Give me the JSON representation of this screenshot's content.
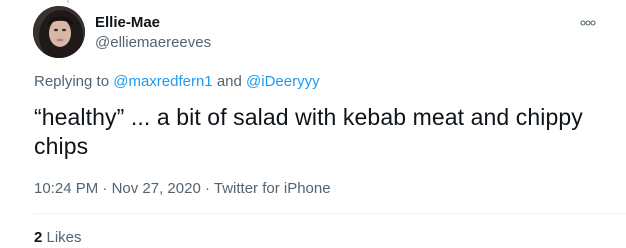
{
  "tweet": {
    "author_name": "Ellie-Mae",
    "author_handle": "@elliemaereeves",
    "replying_prefix": "Replying to ",
    "reply_to_1": "@maxredfern1",
    "reply_and": " and ",
    "reply_to_2": "@iDeeryyy",
    "text": "“healthy” ... a bit of salad with kebab meat and chippy chips",
    "time": "10:24 PM",
    "sep1": " · ",
    "date": "Nov 27, 2020",
    "sep2": " · ",
    "source": "Twitter for iPhone",
    "likes_count": "2",
    "likes_label": " Likes"
  },
  "icons": {
    "more": "more-options-icon"
  },
  "colors": {
    "link": "#1d9bf0",
    "secondary_text": "#536471",
    "primary_text": "#0f1419"
  }
}
